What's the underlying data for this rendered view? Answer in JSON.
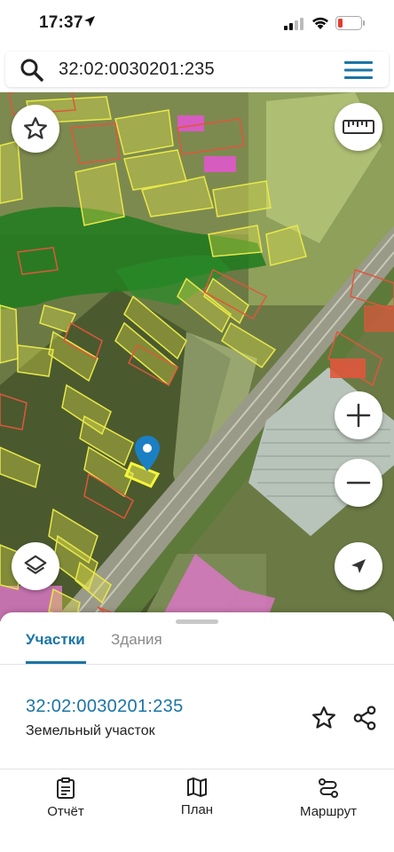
{
  "status_bar": {
    "time": "17:37"
  },
  "search": {
    "query": "32:02:0030201:235"
  },
  "icons": {
    "search": "search-icon",
    "menu": "menu-icon",
    "favorite": "star-icon",
    "ruler": "ruler-icon",
    "zoom_in": "plus-icon",
    "zoom_out": "minus-icon",
    "layers": "layers-icon",
    "locate": "navigation-arrow-icon",
    "pin": "map-pin-icon",
    "share": "share-icon",
    "report": "clipboard-icon",
    "plan": "map-icon",
    "route": "route-icon"
  },
  "sheet": {
    "tabs": [
      {
        "label": "Участки",
        "active": true
      },
      {
        "label": "Здания",
        "active": false
      }
    ],
    "parcel": {
      "id": "32:02:0030201:235",
      "type": "Земельный участок"
    }
  },
  "bottom_nav": [
    {
      "label": "Отчёт"
    },
    {
      "label": "План"
    },
    {
      "label": "Маршрут"
    }
  ],
  "colors": {
    "accent": "#1b75a6",
    "parcel_outline": "#e8e84a",
    "parcel_red": "#e0563c",
    "building_pink": "#d65cc0",
    "forest": "#1f7a1f"
  }
}
